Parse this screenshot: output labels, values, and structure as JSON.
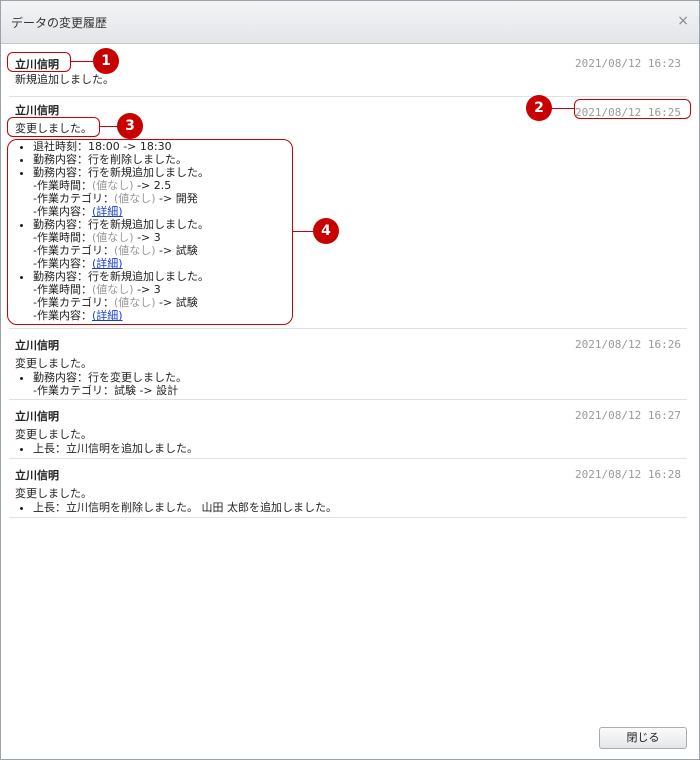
{
  "dialog": {
    "title": "データの変更履歴",
    "close_glyph": "×",
    "close_button": "閉じる"
  },
  "entries": [
    {
      "user": "立川信明",
      "timestamp": "2021/08/12 16:23",
      "message": "新規追加しました。"
    },
    {
      "user": "立川信明",
      "timestamp": "2021/08/12 16:25",
      "message": "変更しました。",
      "changes": {
        "c0": "退社時刻：18:00 -> 18:30",
        "c1": "勤務内容：行を削除しました。",
        "c2": "勤務内容：行を新規追加しました。",
        "c2_s0a": "-作業時間：",
        "c2_s0b": "(値なし)",
        "c2_s0c": " -> 2.5",
        "c2_s1a": "-作業カテゴリ：",
        "c2_s1b": "(値なし)",
        "c2_s1c": " -> 開発",
        "c2_s2a": "-作業内容：",
        "c2_s2link": "(詳細)",
        "c3": "勤務内容：行を新規追加しました。",
        "c3_s0a": "-作業時間：",
        "c3_s0b": "(値なし)",
        "c3_s0c": " -> 3",
        "c3_s1a": "-作業カテゴリ：",
        "c3_s1b": "(値なし)",
        "c3_s1c": " -> 試験",
        "c3_s2a": "-作業内容：",
        "c3_s2link": "(詳細)",
        "c4": "勤務内容：行を新規追加しました。",
        "c4_s0a": "-作業時間：",
        "c4_s0b": "(値なし)",
        "c4_s0c": " -> 3",
        "c4_s1a": "-作業カテゴリ：",
        "c4_s1b": "(値なし)",
        "c4_s1c": " -> 試験",
        "c4_s2a": "-作業内容：",
        "c4_s2link": "(詳細)"
      }
    },
    {
      "user": "立川信明",
      "timestamp": "2021/08/12 16:26",
      "message": "変更しました。",
      "changes": {
        "c0": "勤務内容：行を変更しました。",
        "c0_s0": "-作業カテゴリ：試験 -> 設計"
      }
    },
    {
      "user": "立川信明",
      "timestamp": "2021/08/12 16:27",
      "message": "変更しました。",
      "changes": {
        "c0": "上長：立川信明を追加しました。"
      }
    },
    {
      "user": "立川信明",
      "timestamp": "2021/08/12 16:28",
      "message": "変更しました。",
      "changes": {
        "c0": "上長：立川信明を削除しました。 山田 太郎を追加しました。"
      }
    }
  ],
  "annotations": {
    "b1": "1",
    "b2": "2",
    "b3": "3",
    "b4": "4"
  }
}
